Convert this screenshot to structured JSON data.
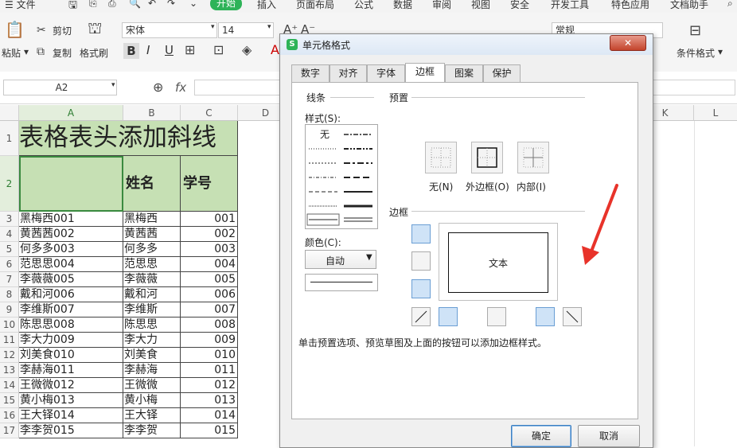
{
  "menu": {
    "items": [
      "☰ 文件",
      "开始",
      "插入",
      "页面布局",
      "公式",
      "数据",
      "审阅",
      "视图",
      "安全",
      "开发工具",
      "特色应用",
      "文档助手"
    ],
    "active": "开始"
  },
  "toolbar": {
    "cut": "剪切",
    "paste": "粘贴",
    "copy": "复制",
    "format_painter": "格式刷",
    "font_name": "宋体",
    "font_size": "14",
    "bold": "B",
    "italic": "I",
    "underline": "U",
    "number_format": "常规",
    "conditional_format": "条件格式"
  },
  "formula_bar": {
    "cell_ref": "A2",
    "fx": "fx",
    "value": ""
  },
  "columns": [
    "A",
    "B",
    "C",
    "D",
    "K",
    "L"
  ],
  "sheet": {
    "title": "表格表头添加斜线",
    "header_b": "姓名",
    "header_c": "学号",
    "row_numbers": [
      "1",
      "2",
      "3",
      "4",
      "5",
      "6",
      "7",
      "8",
      "9",
      "10",
      "11",
      "12",
      "13",
      "14",
      "15",
      "16",
      "17"
    ],
    "rows": [
      [
        "黑梅西001",
        "黑梅西",
        "001"
      ],
      [
        "黄茜茜002",
        "黄茜茜",
        "002"
      ],
      [
        "何多多003",
        "何多多",
        "003"
      ],
      [
        "范思思004",
        "范思思",
        "004"
      ],
      [
        "李薇薇005",
        "李薇薇",
        "005"
      ],
      [
        "戴和河006",
        "戴和河",
        "006"
      ],
      [
        "李维斯007",
        "李维斯",
        "007"
      ],
      [
        "陈思思008",
        "陈思思",
        "008"
      ],
      [
        "李大力009",
        "李大力",
        "009"
      ],
      [
        "刘美食010",
        "刘美食",
        "010"
      ],
      [
        "李赫海011",
        "李赫海",
        "011"
      ],
      [
        "王微微012",
        "王微微",
        "012"
      ],
      [
        "黄小梅013",
        "黄小梅",
        "013"
      ],
      [
        "王大铎014",
        "王大铎",
        "014"
      ],
      [
        "李李贺015",
        "李李贺",
        "015"
      ]
    ]
  },
  "dialog": {
    "title": "单元格格式",
    "tabs": [
      "数字",
      "对齐",
      "字体",
      "边框",
      "图案",
      "保护"
    ],
    "active_tab": "边框",
    "line_group": "线条",
    "style_label": "样式(S):",
    "style_none": "无",
    "color_label": "颜色(C):",
    "color_value": "自动",
    "preset_group": "预置",
    "presets": [
      "无(N)",
      "外边框(O)",
      "内部(I)"
    ],
    "border_group": "边框",
    "preview_text": "文本",
    "hint": "单击预置选项、预览草图及上面的按钮可以添加边框样式。",
    "ok": "确定",
    "cancel": "取消"
  },
  "colors": {
    "accent_green": "#2eb358",
    "header_fill": "#c6e0b4",
    "annotation_arrow": "#e8332a"
  }
}
